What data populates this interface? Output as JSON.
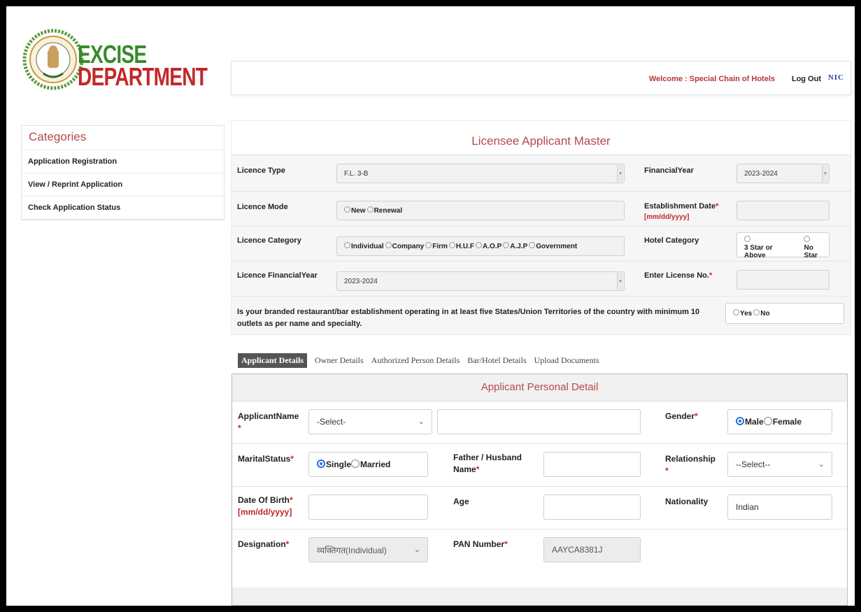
{
  "brand": {
    "line1": "EXCISE",
    "line2": "DEPARTMENT"
  },
  "topbar": {
    "welcome": "Welcome : Special Chain of Hotels",
    "logout": "Log Out",
    "nic": "NIC"
  },
  "sidebar": {
    "title": "Categories",
    "items": [
      {
        "label": "Application Registration"
      },
      {
        "label": "View / Reprint Application"
      },
      {
        "label": "Check Application Status"
      }
    ]
  },
  "master": {
    "title": "Licensee Applicant Master",
    "licence_type": {
      "label": "Licence Type",
      "value": "F.L. 3-B"
    },
    "financial_year": {
      "label": "FinancialYear",
      "value": "2023-2024"
    },
    "licence_mode": {
      "label": "Licence Mode",
      "options": [
        "New",
        "Renewal"
      ]
    },
    "establishment_date": {
      "label": "Establishment Date",
      "hint": "[mm/dd/yyyy]"
    },
    "licence_category": {
      "label": "Licence Category",
      "options": [
        "Individual",
        "Company",
        "Firm",
        "H.U.F",
        "A.O.P",
        "A.J.P",
        "Government"
      ]
    },
    "hotel_category": {
      "label": "Hotel Category",
      "options": [
        "3 Star or Above",
        "No Star"
      ]
    },
    "licence_fy": {
      "label": "Licence FinancialYear",
      "value": "2023-2024"
    },
    "license_no": {
      "label": "Enter License No."
    },
    "branded_question": {
      "label": "Is your branded restaurant/bar establishment operating in at least five States/Union Territories of the country with minimum 10 outlets as per name and specialty.",
      "options": [
        "Yes",
        "No"
      ]
    }
  },
  "tabs": [
    {
      "label": "Applicant Details"
    },
    {
      "label": "Owner Details"
    },
    {
      "label": "Authorized Person Details"
    },
    {
      "label": "Bar/Hotel Details"
    },
    {
      "label": "Upload Documents"
    }
  ],
  "detail": {
    "title": "Applicant Personal Detail",
    "applicant_name": {
      "label": "ApplicantName",
      "select": "-Select-"
    },
    "gender": {
      "label": "Gender",
      "options": [
        "Male",
        "Female"
      ],
      "selected": "Male"
    },
    "marital_status": {
      "label": "MaritalStatus",
      "options": [
        "Single",
        "Married"
      ],
      "selected": "Single"
    },
    "father_husband": {
      "label1": "Father / Husband",
      "label2": "Name"
    },
    "relationship": {
      "label": "Relationship",
      "select": "--Select--"
    },
    "dob": {
      "label": "Date Of Birth",
      "hint": "[mm/dd/yyyy]"
    },
    "age": {
      "label": "Age"
    },
    "nationality": {
      "label": "Nationality",
      "value": "Indian"
    },
    "designation": {
      "label": "Designation",
      "value": "व्यक्तिगत(Individual)"
    },
    "pan": {
      "label": "PAN Number",
      "value": "AAYCA8381J"
    }
  },
  "colors": {
    "accent": "#b54a4a",
    "brand_green": "#3a8a2e",
    "brand_red": "#c2282a",
    "radio_blue": "#2a6fd3"
  }
}
